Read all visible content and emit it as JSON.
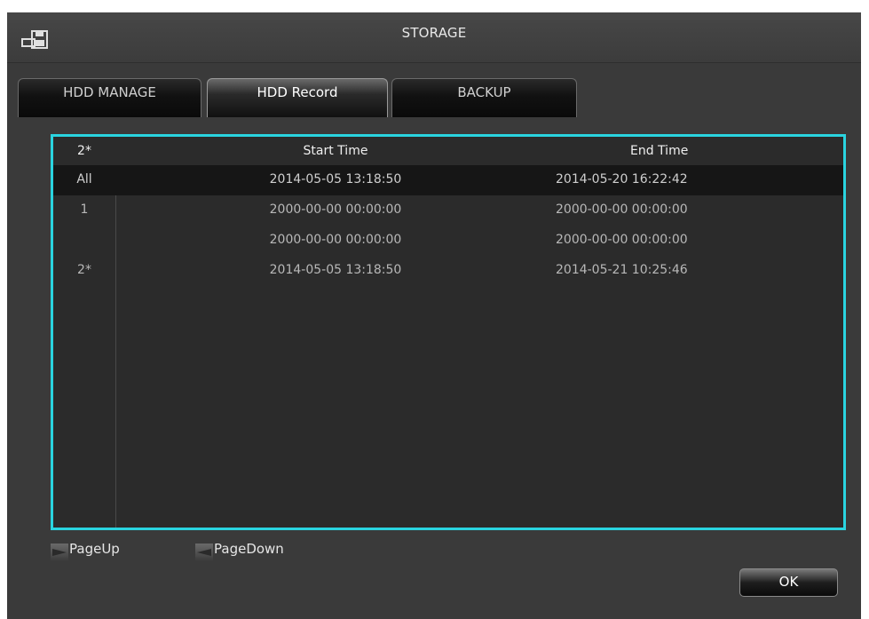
{
  "window": {
    "title": "STORAGE"
  },
  "tabs": [
    {
      "label": "HDD MANAGE",
      "active": false
    },
    {
      "label": "HDD Record",
      "active": true
    },
    {
      "label": "BACKUP",
      "active": false
    }
  ],
  "table": {
    "columns": [
      "2*",
      "Start Time",
      "End Time"
    ],
    "rows": [
      {
        "disk": "All",
        "start": "2014-05-05 13:18:50",
        "end": "2014-05-20 16:22:42",
        "selected": true
      },
      {
        "disk": "1",
        "start": "2000-00-00 00:00:00",
        "end": "2000-00-00 00:00:00",
        "selected": false
      },
      {
        "disk": "",
        "start": "2000-00-00 00:00:00",
        "end": "2000-00-00 00:00:00",
        "selected": false
      },
      {
        "disk": "2*",
        "start": "2014-05-05 13:18:50",
        "end": "2014-05-21 10:25:46",
        "selected": false
      }
    ]
  },
  "pager": {
    "page_up_label": "PageUp",
    "page_down_label": "PageDown"
  },
  "buttons": {
    "ok_label": "OK"
  },
  "colors": {
    "table_border": "#2ad4e0",
    "background": "#3a3a3a",
    "selected_row": "#161616"
  }
}
